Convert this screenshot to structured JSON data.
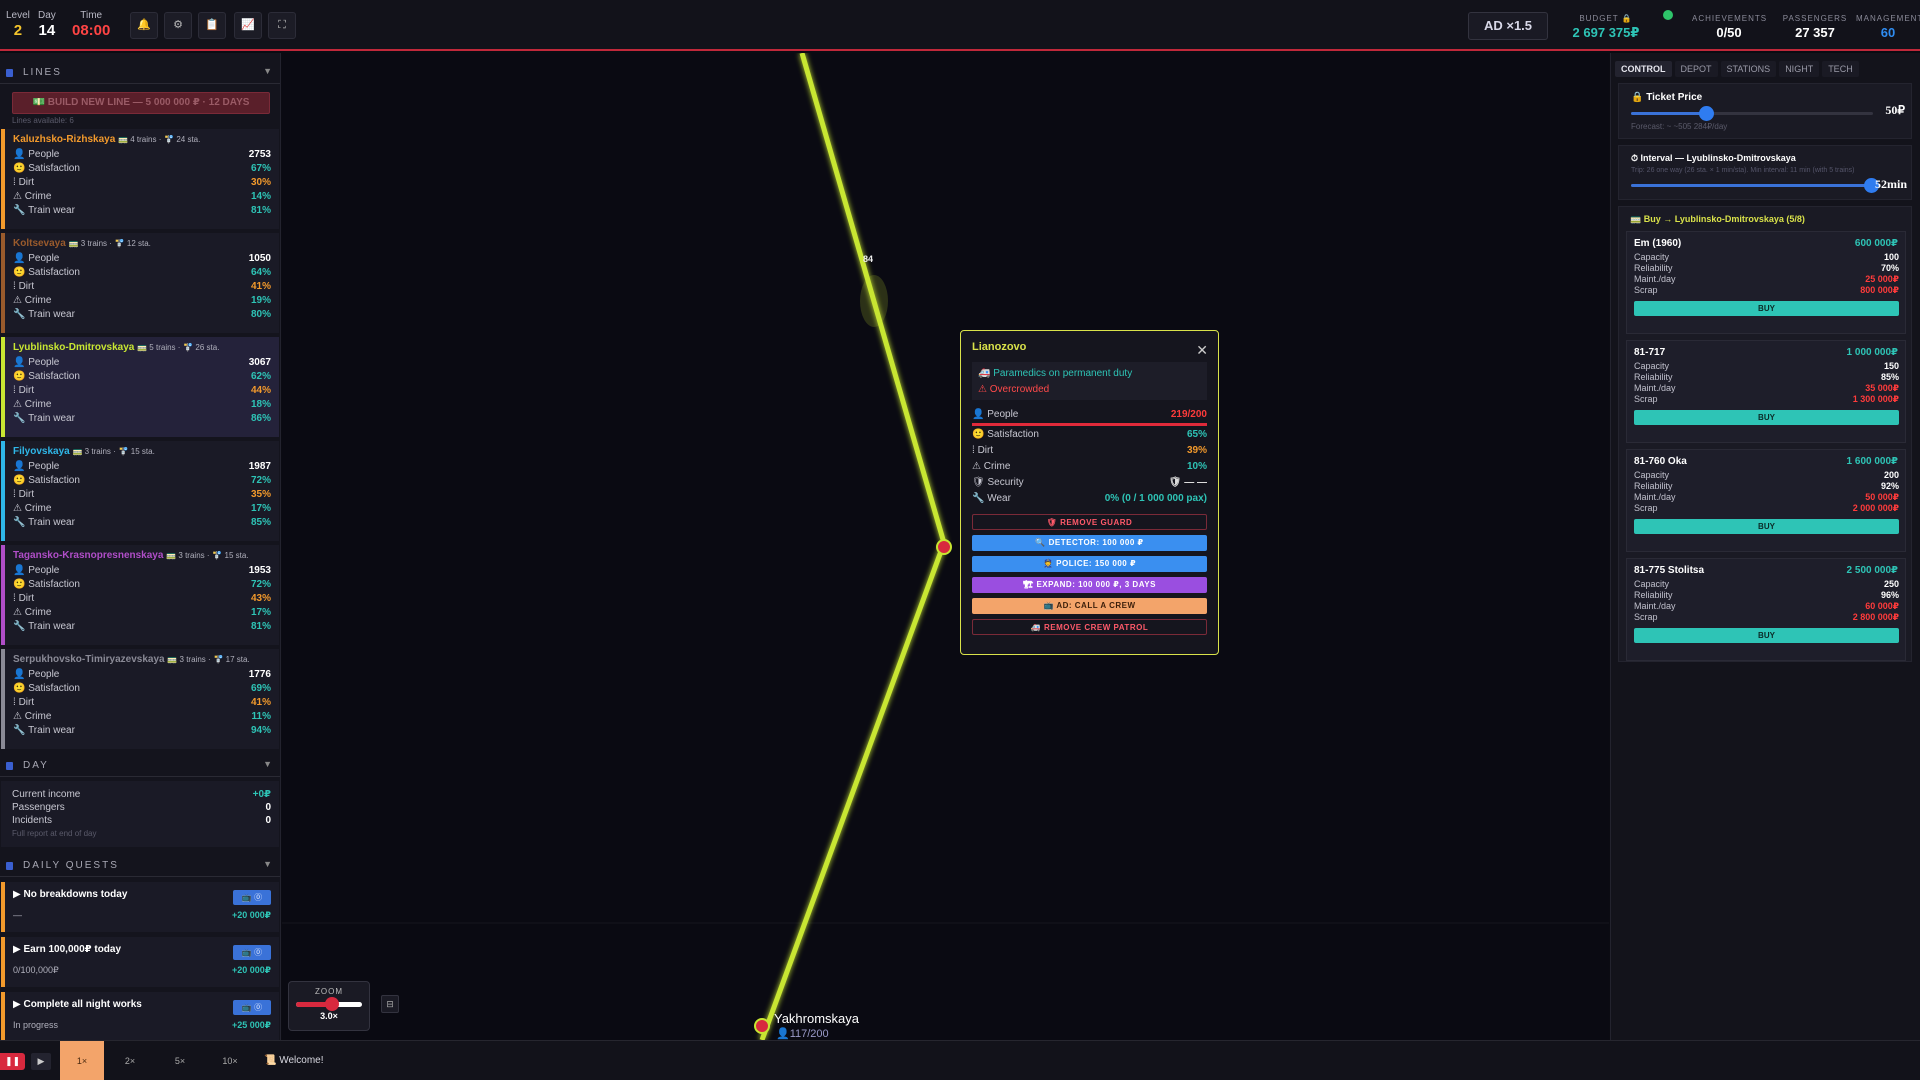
{
  "colors": {
    "accent_red": "#d8293e",
    "line_green": "#c8e632",
    "teal": "#2ec4b6",
    "orange": "#f39a2c",
    "blue": "#3a72d8",
    "yellow": "#d9e24a"
  },
  "topbar": {
    "level_label": "Level",
    "level_value": "2",
    "day_label": "Day",
    "day_value": "14",
    "time_label": "Time",
    "time_value": "08:00",
    "tool_icons": [
      "bell-icon",
      "gear-icon",
      "clipboard-icon",
      "chart-icon",
      "fullscreen-icon"
    ],
    "ad_label": "AD ×1.5",
    "budget_label": "BUDGET 🔒",
    "budget_value": "2 697 375₽",
    "achievements_label": "ACHIEVEMENTS",
    "achievements_value": "0/50",
    "passengers_label": "PASSENGERS",
    "passengers_value": "27 357",
    "management_label": "MANAGEMENT",
    "management_value": "60"
  },
  "left": {
    "lines_header": "LINES",
    "build_button": "💵 BUILD NEW LINE — 5 000 000 ₽ · 12 DAYS",
    "lines_available": "Lines available: 6",
    "row_labels": {
      "people": "People",
      "satisfaction": "Satisfaction",
      "dirt": "Dirt",
      "crime": "Crime",
      "wear": "Train wear"
    },
    "lines": [
      {
        "name": "Kaluzhsko-Rizhskaya",
        "trains": "🚃 4 trains ·",
        "stations": "🚏 24 sta.",
        "color": "#f39a2c",
        "people": "2753",
        "satisfaction": "67%",
        "dirt": "30%",
        "crime": "14%",
        "wear": "81%",
        "sat_color": "#2ec4b6",
        "dirt_color": "#f39a2c",
        "crime_color": "#2ec4b6",
        "wear_color": "#2ec4b6"
      },
      {
        "name": "Koltsevaya",
        "trains": "🚃 3 trains ·",
        "stations": "🚏 12 sta.",
        "color": "#9a5b2c",
        "people": "1050",
        "satisfaction": "64%",
        "dirt": "41%",
        "crime": "19%",
        "wear": "80%",
        "sat_color": "#2ec4b6",
        "dirt_color": "#f39a2c",
        "crime_color": "#2ec4b6",
        "wear_color": "#2ec4b6"
      },
      {
        "name": "Lyublinsko-Dmitrovskaya",
        "trains": "🚃 5 trains ·",
        "stations": "🚏 26 sta.",
        "color": "#c8e632",
        "people": "3067",
        "satisfaction": "62%",
        "dirt": "44%",
        "crime": "18%",
        "wear": "86%",
        "sat_color": "#2ec4b6",
        "dirt_color": "#f39a2c",
        "crime_color": "#2ec4b6",
        "wear_color": "#2ec4b6"
      },
      {
        "name": "Filyovskaya",
        "trains": "🚃 3 trains ·",
        "stations": "🚏 15 sta.",
        "color": "#2fb7e8",
        "people": "1987",
        "satisfaction": "72%",
        "dirt": "35%",
        "crime": "17%",
        "wear": "85%",
        "sat_color": "#2ec4b6",
        "dirt_color": "#f39a2c",
        "crime_color": "#2ec4b6",
        "wear_color": "#2ec4b6"
      },
      {
        "name": "Tagansko-Krasnopresnenskaya",
        "trains": "🚃 3 trains ·",
        "stations": "🚏 15 sta.",
        "color": "#b04ec8",
        "people": "1953",
        "satisfaction": "72%",
        "dirt": "43%",
        "crime": "17%",
        "wear": "81%",
        "sat_color": "#2ec4b6",
        "dirt_color": "#f39a2c",
        "crime_color": "#2ec4b6",
        "wear_color": "#2ec4b6"
      },
      {
        "name": "Serpukhovsko-Timiryazevskaya",
        "trains": "🚃 3 trains ·",
        "stations": "🚏 17 sta.",
        "color": "#8a8a96",
        "people": "1776",
        "satisfaction": "69%",
        "dirt": "41%",
        "crime": "11%",
        "wear": "94%",
        "sat_color": "#2ec4b6",
        "dirt_color": "#f39a2c",
        "crime_color": "#2ec4b6",
        "wear_color": "#2ec4b6"
      }
    ],
    "day_header": "DAY",
    "day": {
      "income_label": "Current income",
      "income_value": "+0₽",
      "passengers_label": "Passengers",
      "passengers_value": "0",
      "incidents_label": "Incidents",
      "incidents_value": "0",
      "note": "Full report at end of day"
    },
    "quests_header": "DAILY QUESTS",
    "quests": [
      {
        "title": "▶ No breakdowns today",
        "progress": "—",
        "badge": "📺 ⓪",
        "reward": "+20 000₽"
      },
      {
        "title": "▶ Earn 100,000₽ today",
        "progress": "0/100,000₽",
        "badge": "📺 ⓪",
        "reward": "+20 000₽"
      },
      {
        "title": "▶ Complete all night works",
        "progress": "In progress",
        "badge": "📺 ⓪",
        "reward": "+25 000₽"
      }
    ]
  },
  "map": {
    "train_number": "84",
    "station_bottom_name": "Yakhromskaya",
    "station_bottom_people": "👤117/200",
    "zoom_label": "ZOOM",
    "zoom_value": "3.0×",
    "zoom_fraction": 0.55,
    "map_button": "⊟"
  },
  "popup": {
    "title": "Lianozovo",
    "close": "✕",
    "note1": "🚑  Paramedics on permanent duty",
    "note2": "⚠  Overcrowded",
    "people_label": "People",
    "people_value": "219/200",
    "satisfaction_label": "Satisfaction",
    "satisfaction_value": "65%",
    "dirt_label": "Dirt",
    "dirt_value": "39%",
    "crime_label": "Crime",
    "crime_value": "10%",
    "security_label": "Security",
    "security_value": "🛡 — —",
    "wear_label": "Wear",
    "wear_value": "0% (0 / 1 000 000 pax)",
    "buttons": {
      "remove_guard": "🛡 REMOVE GUARD",
      "detector": "🔍 DETECTOR: 100 000 ₽",
      "police": "👮 POLICE: 150 000 ₽",
      "expand": "🏗 EXPAND: 100 000 ₽, 3 DAYS",
      "ad_crew": "📺 AD: CALL A CREW",
      "remove_patrol": "🚑 REMOVE CREW PATROL"
    }
  },
  "right": {
    "tabs": [
      "CONTROL",
      "DEPOT",
      "STATIONS",
      "NIGHT",
      "TECH"
    ],
    "ticket_title": "🔒 Ticket Price",
    "ticket_value": "50₽",
    "ticket_fraction": 0.31,
    "forecast": "Forecast: ~ ~505 284₽/day",
    "interval_title": "⏱ Interval — Lyublinsko-Dmitrovskaya",
    "interval_sub": "Trip: 26 one way (26 sta. × 1 min/sta). Min interval: 11 min (with 5 trains)",
    "interval_value": "52min",
    "interval_fraction": 0.99,
    "buy_title": "🚃 Buy → Lyublinsko-Dmitrovskaya (5/8)",
    "train_labels": {
      "capacity": "Capacity",
      "reliability": "Reliability",
      "maint": "Maint./day",
      "scrap": "Scrap"
    },
    "buy_label": "BUY",
    "trains": [
      {
        "name": "Em (1960)",
        "price": "600 000₽",
        "capacity": "100",
        "reliability": "70%",
        "maint": "25 000₽",
        "scrap": "800 000₽"
      },
      {
        "name": "81-717",
        "price": "1 000 000₽",
        "capacity": "150",
        "reliability": "85%",
        "maint": "35 000₽",
        "scrap": "1 300 000₽"
      },
      {
        "name": "81-760 Oka",
        "price": "1 600 000₽",
        "capacity": "200",
        "reliability": "92%",
        "maint": "50 000₽",
        "scrap": "2 000 000₽"
      },
      {
        "name": "81-775 Stolitsa",
        "price": "2 500 000₽",
        "capacity": "250",
        "reliability": "96%",
        "maint": "60 000₽",
        "scrap": "2 800 000₽"
      }
    ]
  },
  "bottom": {
    "pause": "❚❚",
    "play": "▶",
    "speeds": [
      "1×",
      "2×",
      "5×",
      "10×"
    ],
    "welcome": "📜 Welcome!"
  }
}
